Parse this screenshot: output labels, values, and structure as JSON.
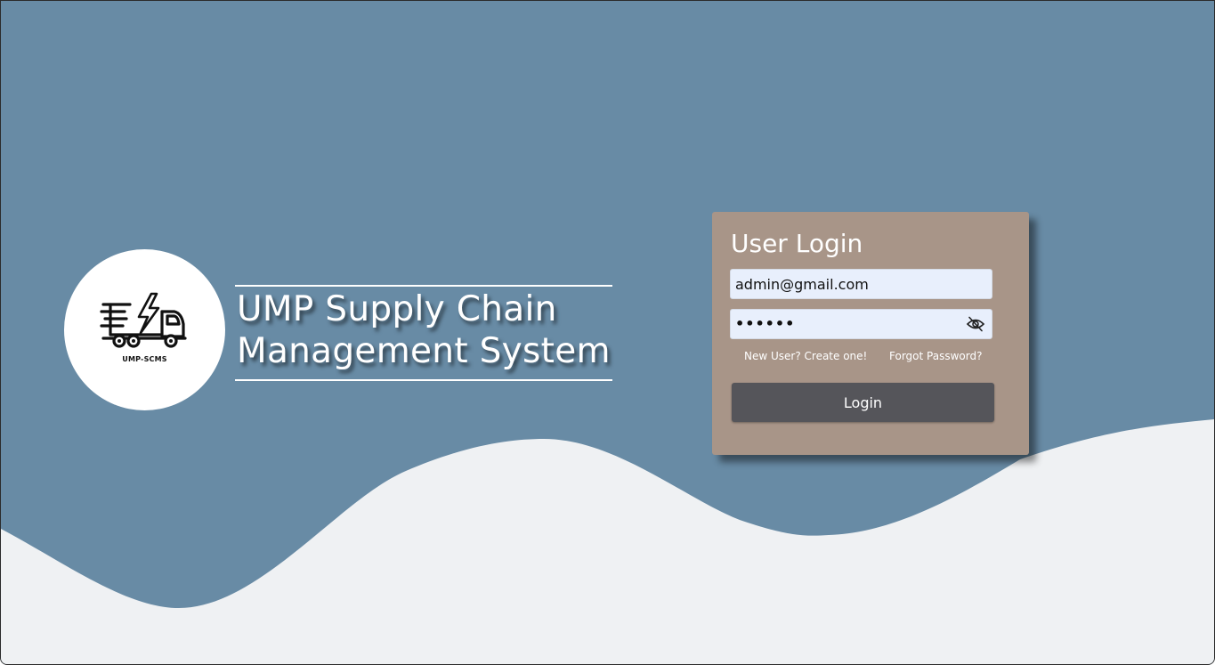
{
  "brand": {
    "logo_text": "UMP-SCMS",
    "title_line1": "UMP Supply Chain",
    "title_line2": "Management System"
  },
  "login": {
    "heading": "User Login",
    "email_value": "admin@gmail.com",
    "password_masked": "••••••",
    "signup_link": "New User? Create one!",
    "forgot_link": "Forgot Password?",
    "submit_label": "Login"
  },
  "icons": {
    "logo": "delivery-truck-lightning-icon",
    "password_toggle": "eye-slash-icon"
  },
  "colors": {
    "background_blue": "#688ba5",
    "wave_light": "#eff1f3",
    "card": "#a89588",
    "input_bg": "#e8effc",
    "button": "#55555a",
    "text_light": "#ffffff"
  }
}
